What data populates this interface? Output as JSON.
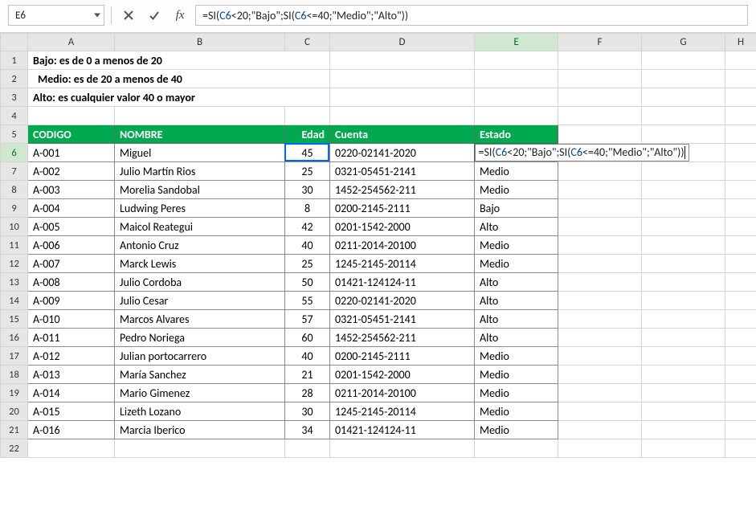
{
  "namebox": "E6",
  "formula_bar": {
    "prefix": "=SI(",
    "ref1": "C6",
    "mid1": "<20;\"Bajo\";SI(",
    "ref2": "C6",
    "mid2": "<=40;\"Medio\";\"Alto\"))"
  },
  "fn_label": "fx",
  "colHeaders": [
    "A",
    "B",
    "C",
    "D",
    "E",
    "F",
    "G",
    "H"
  ],
  "notes": {
    "r1": "Bajo: es de 0 a menos de 20",
    "r2": "Medio: es de 20 a menos de 40",
    "r3": "Alto: es cualquier valor 40 o mayor"
  },
  "headers": {
    "codigo": "CODIGO",
    "nombre": "NOMBRE",
    "edad": "Edad",
    "cuenta": "Cuenta",
    "estado": "Estado"
  },
  "edit_cell": {
    "prefix": "=SI(",
    "ref1": "C6",
    "mid1": "<20;\"Bajo\";SI(",
    "ref2": "C6",
    "mid2": "<=40;\"Medio\";\"Alto\"))"
  },
  "rows": [
    {
      "codigo": "A-001",
      "nombre": "Miguel",
      "edad": 45,
      "cuenta": "0220-02141-2020",
      "estado": ""
    },
    {
      "codigo": "A-002",
      "nombre": "Julio Martín Rios",
      "edad": 25,
      "cuenta": "0321-05451-2141",
      "estado": "Medio"
    },
    {
      "codigo": "A-003",
      "nombre": "Morelia Sandobal",
      "edad": 30,
      "cuenta": "1452-254562-211",
      "estado": "Medio"
    },
    {
      "codigo": "A-004",
      "nombre": "Ludwing Peres",
      "edad": 8,
      "cuenta": "0200-2145-2111",
      "estado": "Bajo"
    },
    {
      "codigo": "A-005",
      "nombre": "Maicol Reategui",
      "edad": 42,
      "cuenta": "0201-1542-2000",
      "estado": "Alto"
    },
    {
      "codigo": "A-006",
      "nombre": "Antonio Cruz",
      "edad": 40,
      "cuenta": "0211-2014-20100",
      "estado": "Medio"
    },
    {
      "codigo": "A-007",
      "nombre": "Marck Lewis",
      "edad": 25,
      "cuenta": "1245-2145-20114",
      "estado": "Medio"
    },
    {
      "codigo": "A-008",
      "nombre": "Julio Cordoba",
      "edad": 50,
      "cuenta": "01421-124124-11",
      "estado": "Alto"
    },
    {
      "codigo": "A-009",
      "nombre": "Julio Cesar",
      "edad": 55,
      "cuenta": "0220-02141-2020",
      "estado": "Alto"
    },
    {
      "codigo": "A-010",
      "nombre": "Marcos Alvares",
      "edad": 57,
      "cuenta": "0321-05451-2141",
      "estado": "Alto"
    },
    {
      "codigo": "A-011",
      "nombre": "Pedro Noriega",
      "edad": 60,
      "cuenta": "1452-254562-211",
      "estado": "Alto"
    },
    {
      "codigo": "A-012",
      "nombre": "Julian portocarrero",
      "edad": 40,
      "cuenta": "0200-2145-2111",
      "estado": "Medio"
    },
    {
      "codigo": "A-013",
      "nombre": "María Sanchez",
      "edad": 21,
      "cuenta": "0201-1542-2000",
      "estado": "Medio"
    },
    {
      "codigo": "A-014",
      "nombre": "Mario Gimenez",
      "edad": 28,
      "cuenta": "0211-2014-20100",
      "estado": "Medio"
    },
    {
      "codigo": "A-015",
      "nombre": "Lizeth Lozano",
      "edad": 30,
      "cuenta": "1245-2145-20114",
      "estado": "Medio"
    },
    {
      "codigo": "A-016",
      "nombre": "Marcia Iberico",
      "edad": 34,
      "cuenta": "01421-124124-11",
      "estado": "Medio"
    }
  ],
  "active_col": "E",
  "active_row": 6
}
